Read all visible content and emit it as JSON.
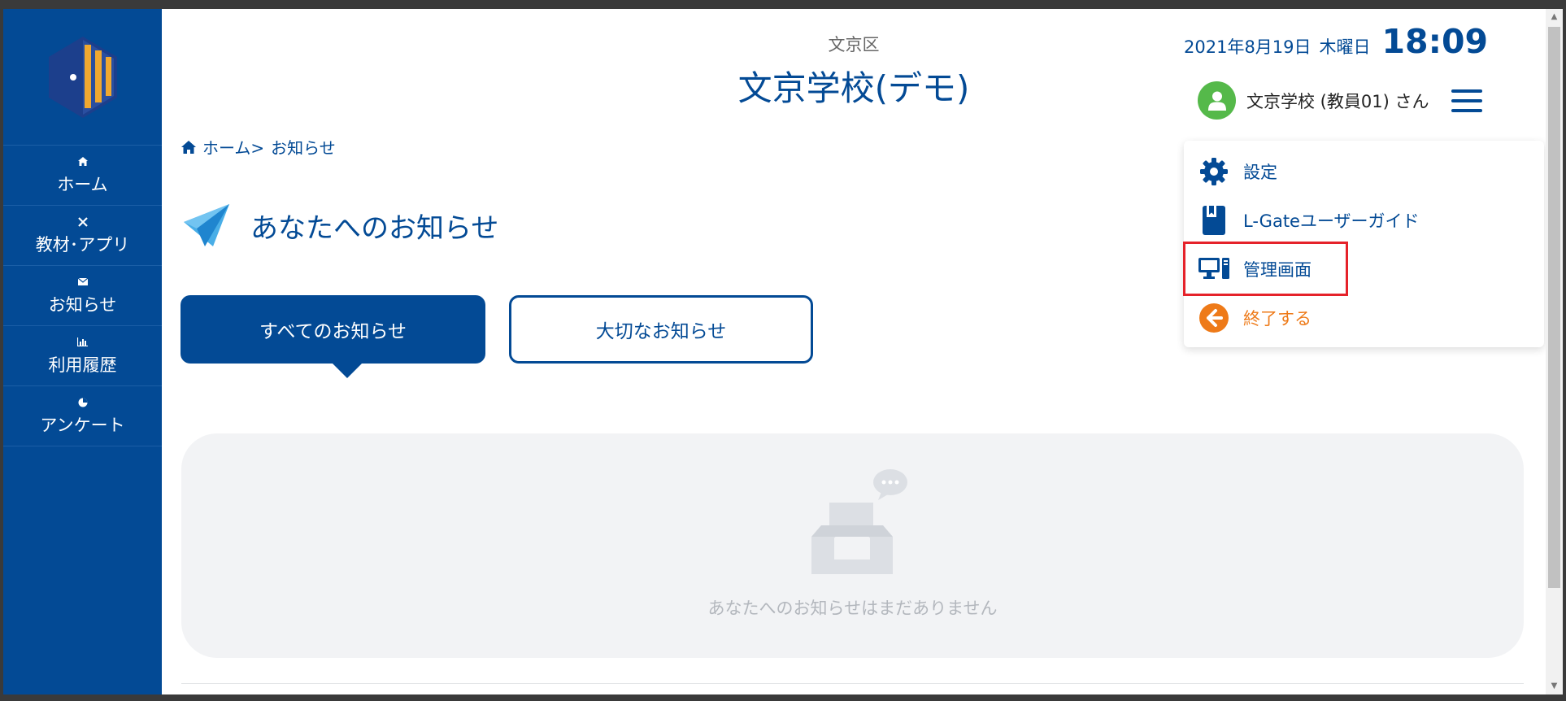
{
  "header": {
    "district": "文京区",
    "school_name": "文京学校(デモ)",
    "date": "2021年8月19日",
    "weekday": "木曜日",
    "time": "18:09",
    "user_name": "文京学校 (教員01) さん"
  },
  "sidebar": {
    "items": [
      {
        "label": "ホーム",
        "icon": "home-icon"
      },
      {
        "label": "教材･アプリ",
        "icon": "tools-icon"
      },
      {
        "label": "お知らせ",
        "icon": "envelope-icon"
      },
      {
        "label": "利用履歴",
        "icon": "bar-chart-icon"
      },
      {
        "label": "アンケート",
        "icon": "pie-chart-icon"
      }
    ]
  },
  "user_menu": {
    "items": [
      {
        "label": "設定",
        "icon": "gear-icon"
      },
      {
        "label": "L-Gateユーザーガイド",
        "icon": "book-icon"
      },
      {
        "label": "管理画面",
        "icon": "desktop-icon",
        "highlighted": true
      },
      {
        "label": "終了する",
        "icon": "arrow-left-circle-icon"
      }
    ]
  },
  "breadcrumb": {
    "home": "ホーム>",
    "current": "お知らせ"
  },
  "page": {
    "title": "あなたへのお知らせ",
    "tabs": [
      {
        "label": "すべてのお知らせ",
        "active": true
      },
      {
        "label": "大切なお知らせ",
        "active": false
      }
    ],
    "empty_message": "あなたへのお知らせはまだありません"
  },
  "colors": {
    "primary": "#034a95",
    "avatar": "#55b94a",
    "exit": "#ee7a18",
    "highlight": "#e5222a",
    "logo_gold": "#f0a830",
    "logo_navy": "#1c3f8c"
  }
}
